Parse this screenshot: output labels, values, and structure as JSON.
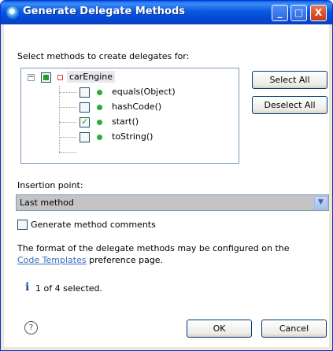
{
  "window": {
    "title": "Generate Delegate Methods",
    "buttons": {
      "minimize": "_",
      "maximize": "□",
      "close": "X"
    }
  },
  "select_label": "Select methods to create delegates for:",
  "tree": {
    "root": {
      "label": "carEngine",
      "state": "partial"
    },
    "items": [
      {
        "label": "equals(Object)",
        "checked": false
      },
      {
        "label": "hashCode()",
        "checked": false
      },
      {
        "label": "start()",
        "checked": true
      },
      {
        "label": "toString()",
        "checked": false
      }
    ]
  },
  "side_buttons": {
    "select_all": "Select All",
    "deselect_all": "Deselect All"
  },
  "insertion": {
    "label": "Insertion point:",
    "value": "Last method"
  },
  "comments": {
    "label": "Generate method comments",
    "checked": false
  },
  "info": {
    "line1": "The format of the delegate methods may be configured on the",
    "link": "Code Templates",
    "line2_suffix": " preference page."
  },
  "status": {
    "icon": "i",
    "text": "1 of 4 selected."
  },
  "footer": {
    "help_icon": "?",
    "ok": "OK",
    "cancel": "Cancel"
  }
}
